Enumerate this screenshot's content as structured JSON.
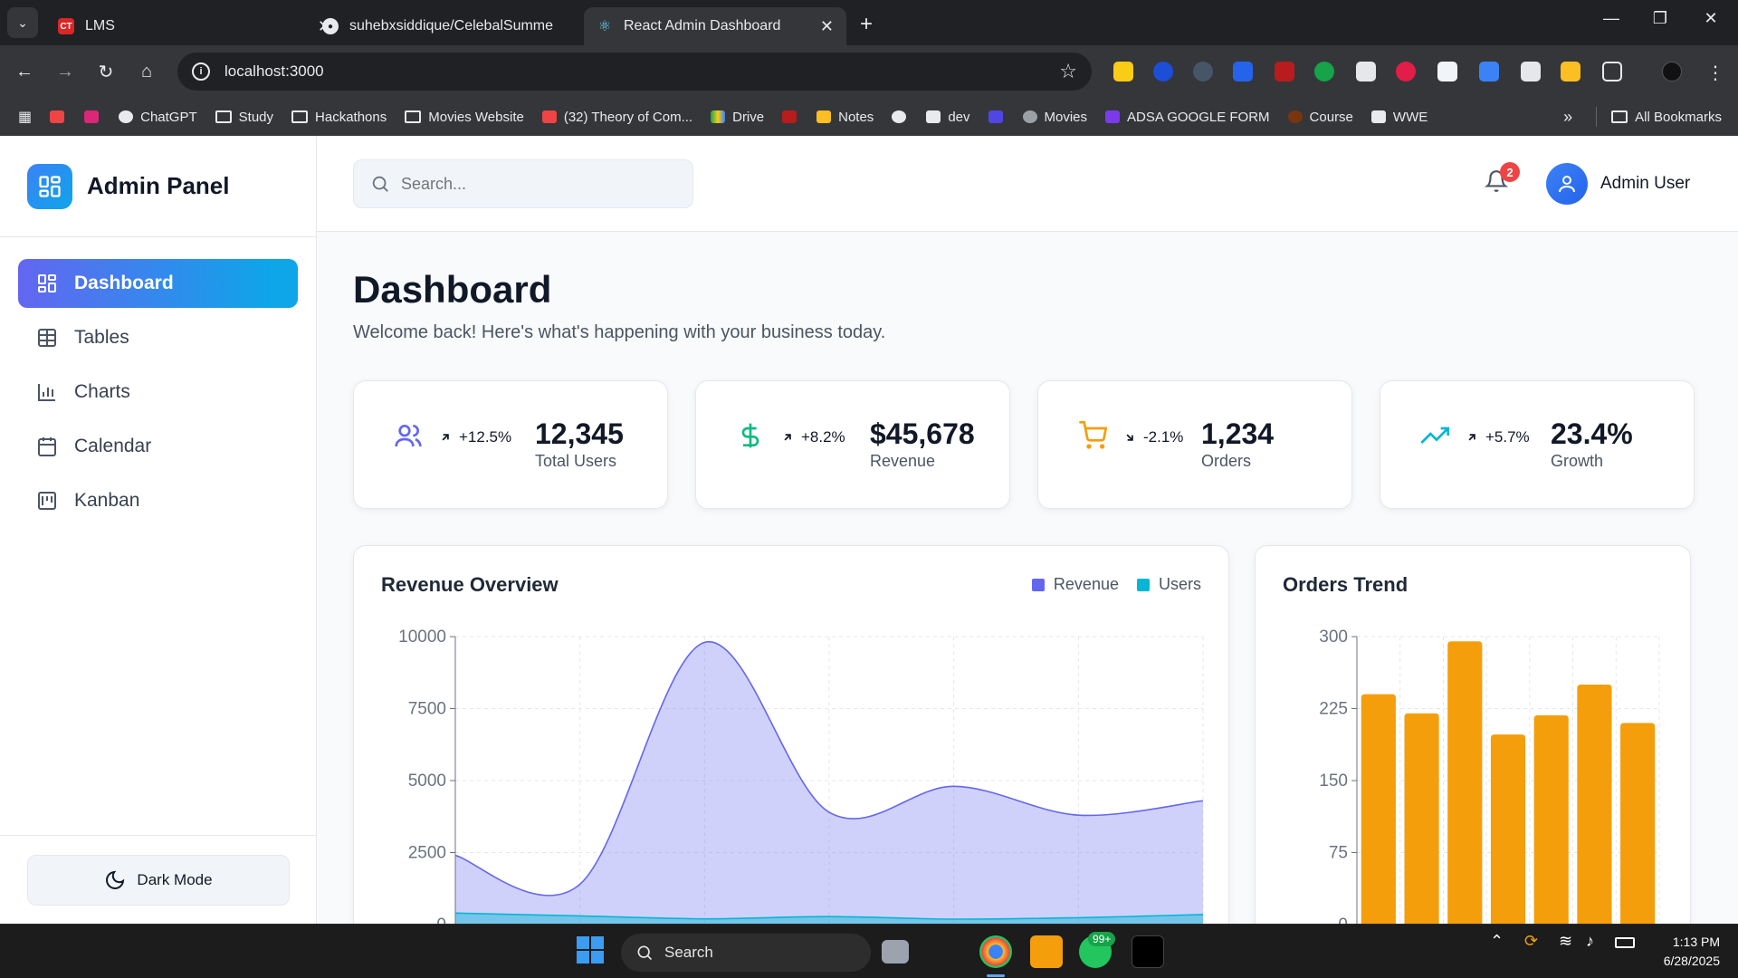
{
  "browser": {
    "tabs": [
      {
        "title": "LMS",
        "active": false
      },
      {
        "title": "suhebxsiddique/CelebalSumme",
        "active": false
      },
      {
        "title": "React Admin Dashboard",
        "active": true
      }
    ],
    "url": "localhost:3000",
    "bookmarks": [
      "ChatGPT",
      "Study",
      "Hackathons",
      "Movies Website",
      "(32) Theory of Com...",
      "Drive",
      "Notes",
      "dev",
      "Movies",
      "ADSA GOOGLE FORM",
      "Course",
      "WWE"
    ],
    "all_bookmarks": "All Bookmarks"
  },
  "sidebar": {
    "brand": "Admin Panel",
    "items": [
      {
        "label": "Dashboard",
        "icon": "dashboard-icon",
        "active": true
      },
      {
        "label": "Tables",
        "icon": "table-icon",
        "active": false
      },
      {
        "label": "Charts",
        "icon": "bar-chart-icon",
        "active": false
      },
      {
        "label": "Calendar",
        "icon": "calendar-icon",
        "active": false
      },
      {
        "label": "Kanban",
        "icon": "kanban-icon",
        "active": false
      }
    ],
    "dark_mode_label": "Dark Mode"
  },
  "header": {
    "search_placeholder": "Search...",
    "notification_count": "2",
    "user_name": "Admin User"
  },
  "main": {
    "title": "Dashboard",
    "subtitle": "Welcome back! Here's what's happening with your business today.",
    "stats": [
      {
        "icon": "users-icon",
        "change": "+12.5%",
        "direction": "up",
        "value": "12,345",
        "label": "Total Users",
        "color": "#6366f1"
      },
      {
        "icon": "dollar-icon",
        "change": "+8.2%",
        "direction": "up",
        "value": "$45,678",
        "label": "Revenue",
        "color": "#10b981"
      },
      {
        "icon": "cart-icon",
        "change": "-2.1%",
        "direction": "down",
        "value": "1,234",
        "label": "Orders",
        "color": "#f59e0b"
      },
      {
        "icon": "trending-up-icon",
        "change": "+5.7%",
        "direction": "up",
        "value": "23.4%",
        "label": "Growth",
        "color": "#06b6d4"
      }
    ],
    "revenue_card": {
      "title": "Revenue Overview",
      "legend": [
        {
          "name": "Revenue",
          "color": "#6366f1"
        },
        {
          "name": "Users",
          "color": "#06b6d4"
        }
      ]
    },
    "orders_card": {
      "title": "Orders Trend"
    }
  },
  "chart_data": [
    {
      "type": "area",
      "title": "Revenue Overview",
      "yticks": [
        "10000",
        "7500",
        "5000",
        "2500",
        "0"
      ],
      "ylim": [
        0,
        10000
      ],
      "series": [
        {
          "name": "Revenue",
          "color": "#6366f1",
          "values": [
            2400,
            1400,
            9800,
            3900,
            4800,
            3800,
            4300
          ]
        },
        {
          "name": "Users",
          "color": "#06b6d4",
          "values": [
            400,
            300,
            200,
            278,
            189,
            239,
            349
          ]
        }
      ],
      "grid": true,
      "legend": "top-right"
    },
    {
      "type": "bar",
      "title": "Orders Trend",
      "yticks": [
        "300",
        "225",
        "150",
        "75",
        "0"
      ],
      "ylim": [
        0,
        300
      ],
      "values": [
        240,
        220,
        295,
        198,
        218,
        250,
        210
      ],
      "color": "#f59e0b",
      "grid": true
    }
  ],
  "taskbar": {
    "search_label": "Search",
    "whatsapp_badge": "99+",
    "time": "1:13 PM",
    "date": "6/28/2025"
  }
}
